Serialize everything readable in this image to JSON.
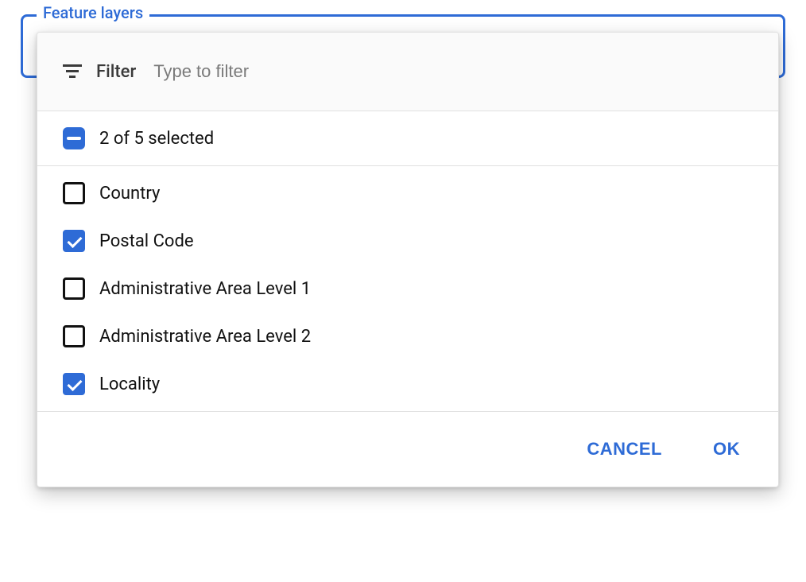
{
  "colors": {
    "accent": "#2e6bd6"
  },
  "fieldset": {
    "legend": "Feature layers"
  },
  "filter": {
    "label": "Filter",
    "placeholder": "Type to filter",
    "value": ""
  },
  "summary": {
    "text": "2 of 5 selected"
  },
  "options": [
    {
      "label": "Country",
      "checked": false
    },
    {
      "label": "Postal Code",
      "checked": true
    },
    {
      "label": "Administrative Area Level 1",
      "checked": false
    },
    {
      "label": "Administrative Area Level 2",
      "checked": false
    },
    {
      "label": "Locality",
      "checked": true
    }
  ],
  "actions": {
    "cancel": "CANCEL",
    "ok": "OK"
  }
}
